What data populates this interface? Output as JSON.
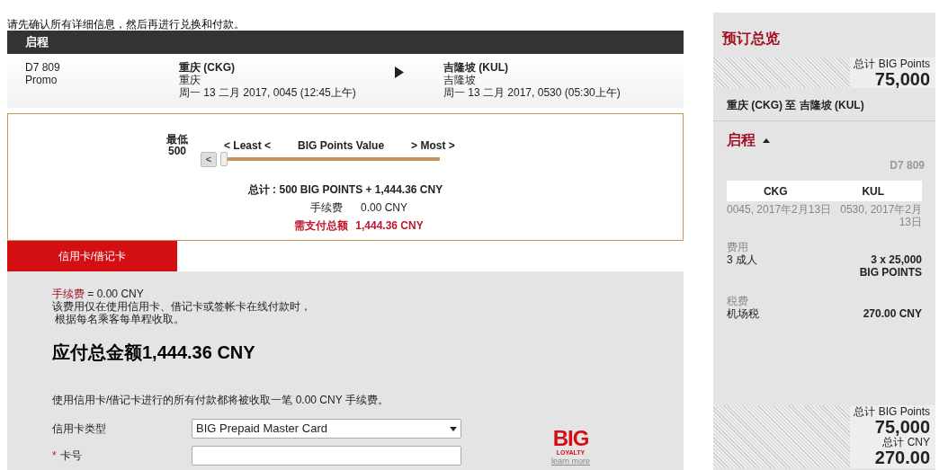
{
  "notice": "请先确认所有详细信息，然后再进行兑换和付款。",
  "flight_header": "启程",
  "flight": {
    "number": "D7 809",
    "fare": "Promo",
    "from": {
      "city_code": "重庆 (CKG)",
      "city": "重庆",
      "time": "周一 13 二月 2017, 0045 (12:45上午)"
    },
    "to": {
      "city_code": "吉隆坡 (KUL)",
      "city": "吉隆坡",
      "time": "周一 13 二月 2017, 0530 (05:30上午)"
    }
  },
  "points_slider": {
    "min_label": "最低",
    "min_value": "500",
    "left_button": "<",
    "least_label": "< Least <",
    "title": "BIG Points Value",
    "most_label": "> Most >",
    "level": 0
  },
  "totals": {
    "total_label": "总计 :",
    "total_value": "500 BIG POINTS + 1,444.36 CNY",
    "fee_label": "手续费",
    "fee_value": "0.00 CNY",
    "due_label": "需支付总额",
    "due_value": "1,444.36 CNY"
  },
  "payment_tabs": [
    {
      "label": "信用卡/借记卡",
      "selected": true
    }
  ],
  "payment": {
    "fee_label": "手续费",
    "fee_value": "= 0.00 CNY",
    "fee_note_1": "该费用仅在使用信用卡、借记卡或签帐卡在线付款时，",
    "fee_note_2": "根据每名乘客每单程收取。",
    "amount_due": "应付总金额1,444.36 CNY",
    "card_note": "使用信用卡/借记卡进行的所有付款都将被收取一笔 0.00 CNY 手续费。",
    "card_type_label": "信用卡类型",
    "card_type_value": "BIG Prepaid Master Card",
    "card_number_required": "*",
    "card_number_label": "卡号",
    "logo_big": "BIG",
    "logo_loyalty": "LOYALTY",
    "learn_more": "learn more"
  },
  "summary": {
    "title": "预订总览",
    "top_points_label": "总计 BIG Points",
    "top_points": "75,000",
    "route": "重庆 (CKG) 至 吉隆坡 (KUL)",
    "section": "启程",
    "expanded": true,
    "flight_number": "D7 809",
    "from_code": "CKG",
    "to_code": "KUL",
    "from_time": "0045, 2017年2月13日",
    "to_time": "0530, 2017年2月13日",
    "fees_label": "费用",
    "fees_item": "3 成人",
    "fees_value_1": "3 x 25,000",
    "fees_value_2": "BIG POINTS",
    "tax_label": "税费",
    "tax_item": "机场税",
    "tax_value": "270.00 CNY",
    "bottom_points_label": "总计 BIG Points",
    "bottom_points": "75,000",
    "bottom_cny_label": "总计 CNY",
    "bottom_cny": "270.00"
  }
}
